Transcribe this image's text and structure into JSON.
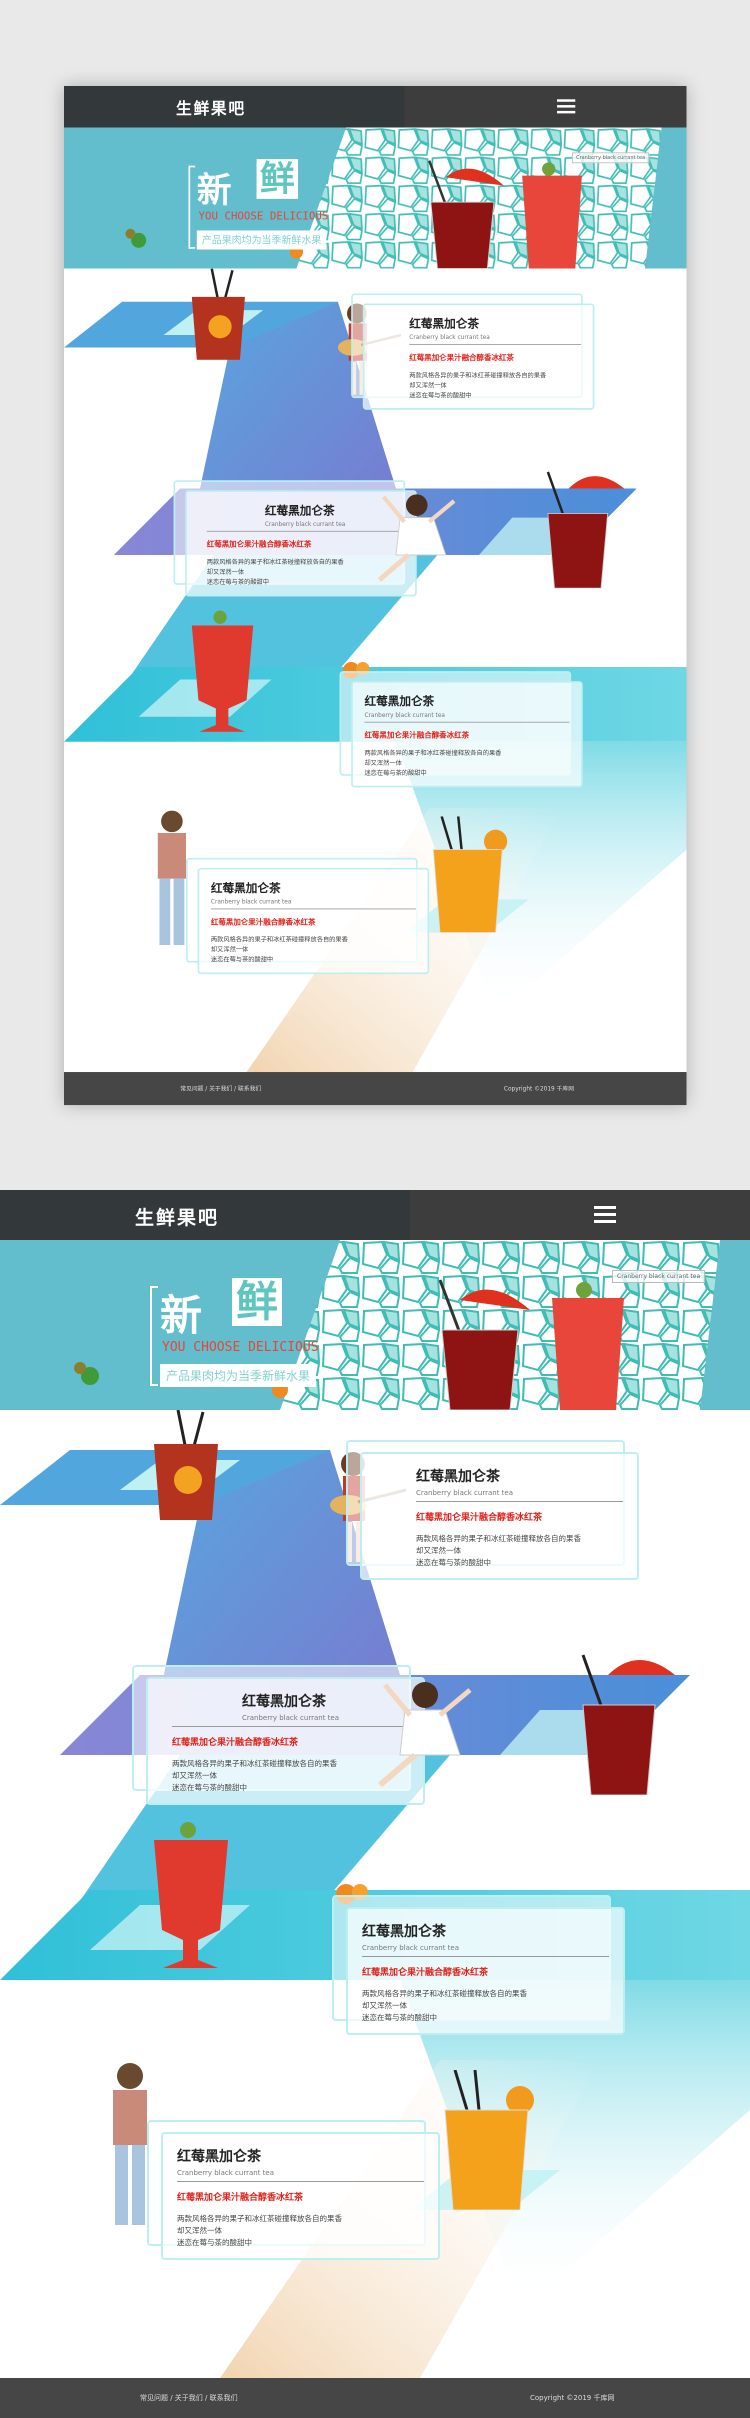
{
  "header": {
    "brand": "生鲜果吧",
    "menu_icon": "hamburger-menu-icon"
  },
  "hero": {
    "title_char1": "新",
    "title_char2": "鲜",
    "slogan_en": "YOU CHOOSE DELICIOUS",
    "slogan_cn": "产品果肉均为当季新鲜水果",
    "label": "Cranberry black currant tea"
  },
  "colors": {
    "header": "#33393a",
    "teal": "#5bbccc",
    "accent_red": "#e2231a",
    "footer": "#464646"
  },
  "products": [
    {
      "title": "红莓黑加仑茶",
      "subtitle": "Cranberry black currant tea",
      "highlight": "红莓黑加仑果汁融合醇香冰红茶",
      "desc": [
        "两款风格各异的果子和冰红茶碰撞释放各自的果香",
        "却又浑然一体",
        "迷恋在莓与茶的酸甜中"
      ]
    },
    {
      "title": "红莓黑加仑茶",
      "subtitle": "Cranberry black currant tea",
      "highlight": "红莓黑加仑果汁融合醇香冰红茶",
      "desc": [
        "两款风格各异的果子和冰红茶碰撞释放各自的果香",
        "却又浑然一体",
        "迷恋在莓与茶的酸甜中"
      ]
    },
    {
      "title": "红莓黑加仑茶",
      "subtitle": "Cranberry black currant tea",
      "highlight": "红莓黑加仑果汁融合醇香冰红茶",
      "desc": [
        "两款风格各异的果子和冰红茶碰撞释放各自的果香",
        "却又浑然一体",
        "迷恋在莓与茶的酸甜中"
      ]
    },
    {
      "title": "红莓黑加仑茶",
      "subtitle": "Cranberry black currant tea",
      "highlight": "红莓黑加仑果汁融合醇香冰红茶",
      "desc": [
        "两款风格各异的果子和冰红茶碰撞释放各自的果香",
        "却又浑然一体",
        "迷恋在莓与茶的酸甜中"
      ]
    }
  ],
  "footer": {
    "links": "常见问题 / 关于我们 / 联系我们",
    "copyright": "Copyright ©2019 千库网"
  }
}
